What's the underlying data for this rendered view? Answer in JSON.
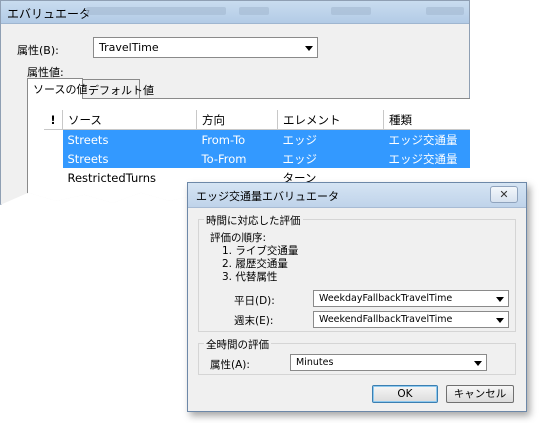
{
  "back_window": {
    "title": "エバリュエータ",
    "attribute_label": "属性(B):",
    "attribute_value": "TravelTime",
    "attribute_values_label": "属性値:",
    "tabs": [
      {
        "label": "ソースの値",
        "active": true
      },
      {
        "label": "デフォルト値",
        "active": false
      }
    ],
    "table": {
      "headers": [
        "!",
        "ソース",
        "方向",
        "エレメント",
        "種類"
      ],
      "rows": [
        {
          "source": "Streets",
          "direction": "From-To",
          "element": "エッジ",
          "type": "エッジ交通量",
          "selected": true
        },
        {
          "source": "Streets",
          "direction": "To-From",
          "element": "エッジ",
          "type": "エッジ交通量",
          "selected": true
        },
        {
          "source": "RestrictedTurns",
          "direction": "",
          "element": "ターン",
          "type": "",
          "selected": false
        }
      ]
    }
  },
  "dialog": {
    "title": "エッジ交通量エバリュエータ",
    "time_group": {
      "title": "時間に対応した評価",
      "order_label": "評価の順序:",
      "order_items": [
        "1. ライブ交通量",
        "2. 履歴交通量",
        "3. 代替属性"
      ],
      "weekday_label": "平日(D):",
      "weekday_value": "WeekdayFallbackTravelTime",
      "weekend_label": "週末(E):",
      "weekend_value": "WeekendFallbackTravelTime"
    },
    "all_time_group": {
      "title": "全時間の評価",
      "attribute_label": "属性(A):",
      "attribute_value": "Minutes"
    },
    "ok_label": "OK",
    "cancel_label": "キャンセル",
    "close_glyph": "✕"
  },
  "colors": {
    "selection": "#3399ff",
    "titlebar": "#bfd3ea"
  }
}
